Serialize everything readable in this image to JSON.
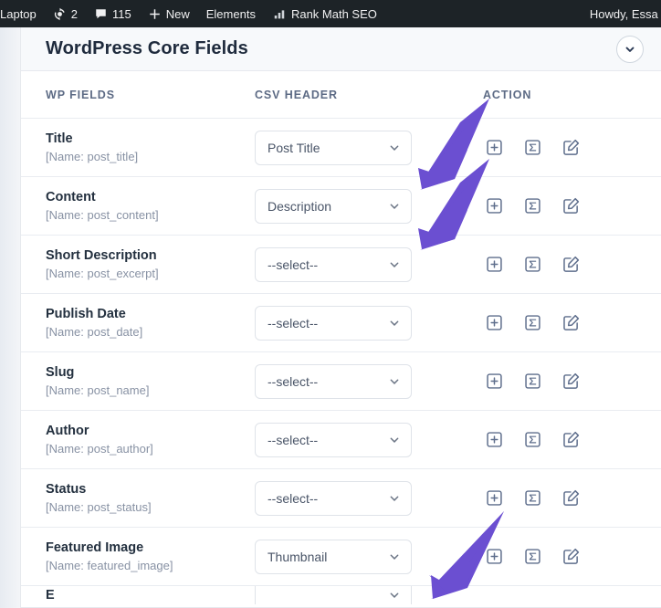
{
  "adminbar": {
    "site_name": "Laptop",
    "updates_icon": "updates-icon",
    "updates_count": "2",
    "comments_icon": "comment-bubble-icon",
    "comments_count": "115",
    "new_icon": "plus-icon",
    "new_label": "New",
    "elements_label": "Elements",
    "rankmath_icon": "bar-chart-icon",
    "rankmath_label": "Rank Math SEO",
    "howdy_label": "Howdy, Essa ."
  },
  "card": {
    "title": "WordPress Core Fields",
    "collapse_icon": "chevron-down-icon"
  },
  "table": {
    "headers": {
      "field": "WP FIELDS",
      "csv": "CSV HEADER",
      "action": "ACTION"
    },
    "select_placeholder": "--select--",
    "action_icons": {
      "add": "plus-square-icon",
      "formula": "sigma-square-icon",
      "edit": "pencil-square-icon"
    },
    "rows": [
      {
        "label": "Title",
        "slug": "[Name: post_title]",
        "value": "Post Title"
      },
      {
        "label": "Content",
        "slug": "[Name: post_content]",
        "value": "Description"
      },
      {
        "label": "Short Description",
        "slug": "[Name: post_excerpt]",
        "value": "--select--"
      },
      {
        "label": "Publish Date",
        "slug": "[Name: post_date]",
        "value": "--select--"
      },
      {
        "label": "Slug",
        "slug": "[Name: post_name]",
        "value": "--select--"
      },
      {
        "label": "Author",
        "slug": "[Name: post_author]",
        "value": "--select--"
      },
      {
        "label": "Status",
        "slug": "[Name: post_status]",
        "value": "--select--"
      },
      {
        "label": "Featured Image",
        "slug": "[Name: featured_image]",
        "value": "Thumbnail"
      }
    ]
  },
  "annotations": {
    "color": "#6b4fd1",
    "arrows": [
      {
        "name": "arrow-to-post-title-select"
      },
      {
        "name": "arrow-to-description-select"
      },
      {
        "name": "arrow-to-thumbnail-select"
      }
    ]
  },
  "colors": {
    "adminbar_bg": "#1d2327",
    "page_bg": "#eef1f5",
    "card_bg": "#ffffff",
    "header_text": "#5d6b85",
    "icon": "#5e6e8c",
    "accent_purple": "#6b4fd1"
  }
}
